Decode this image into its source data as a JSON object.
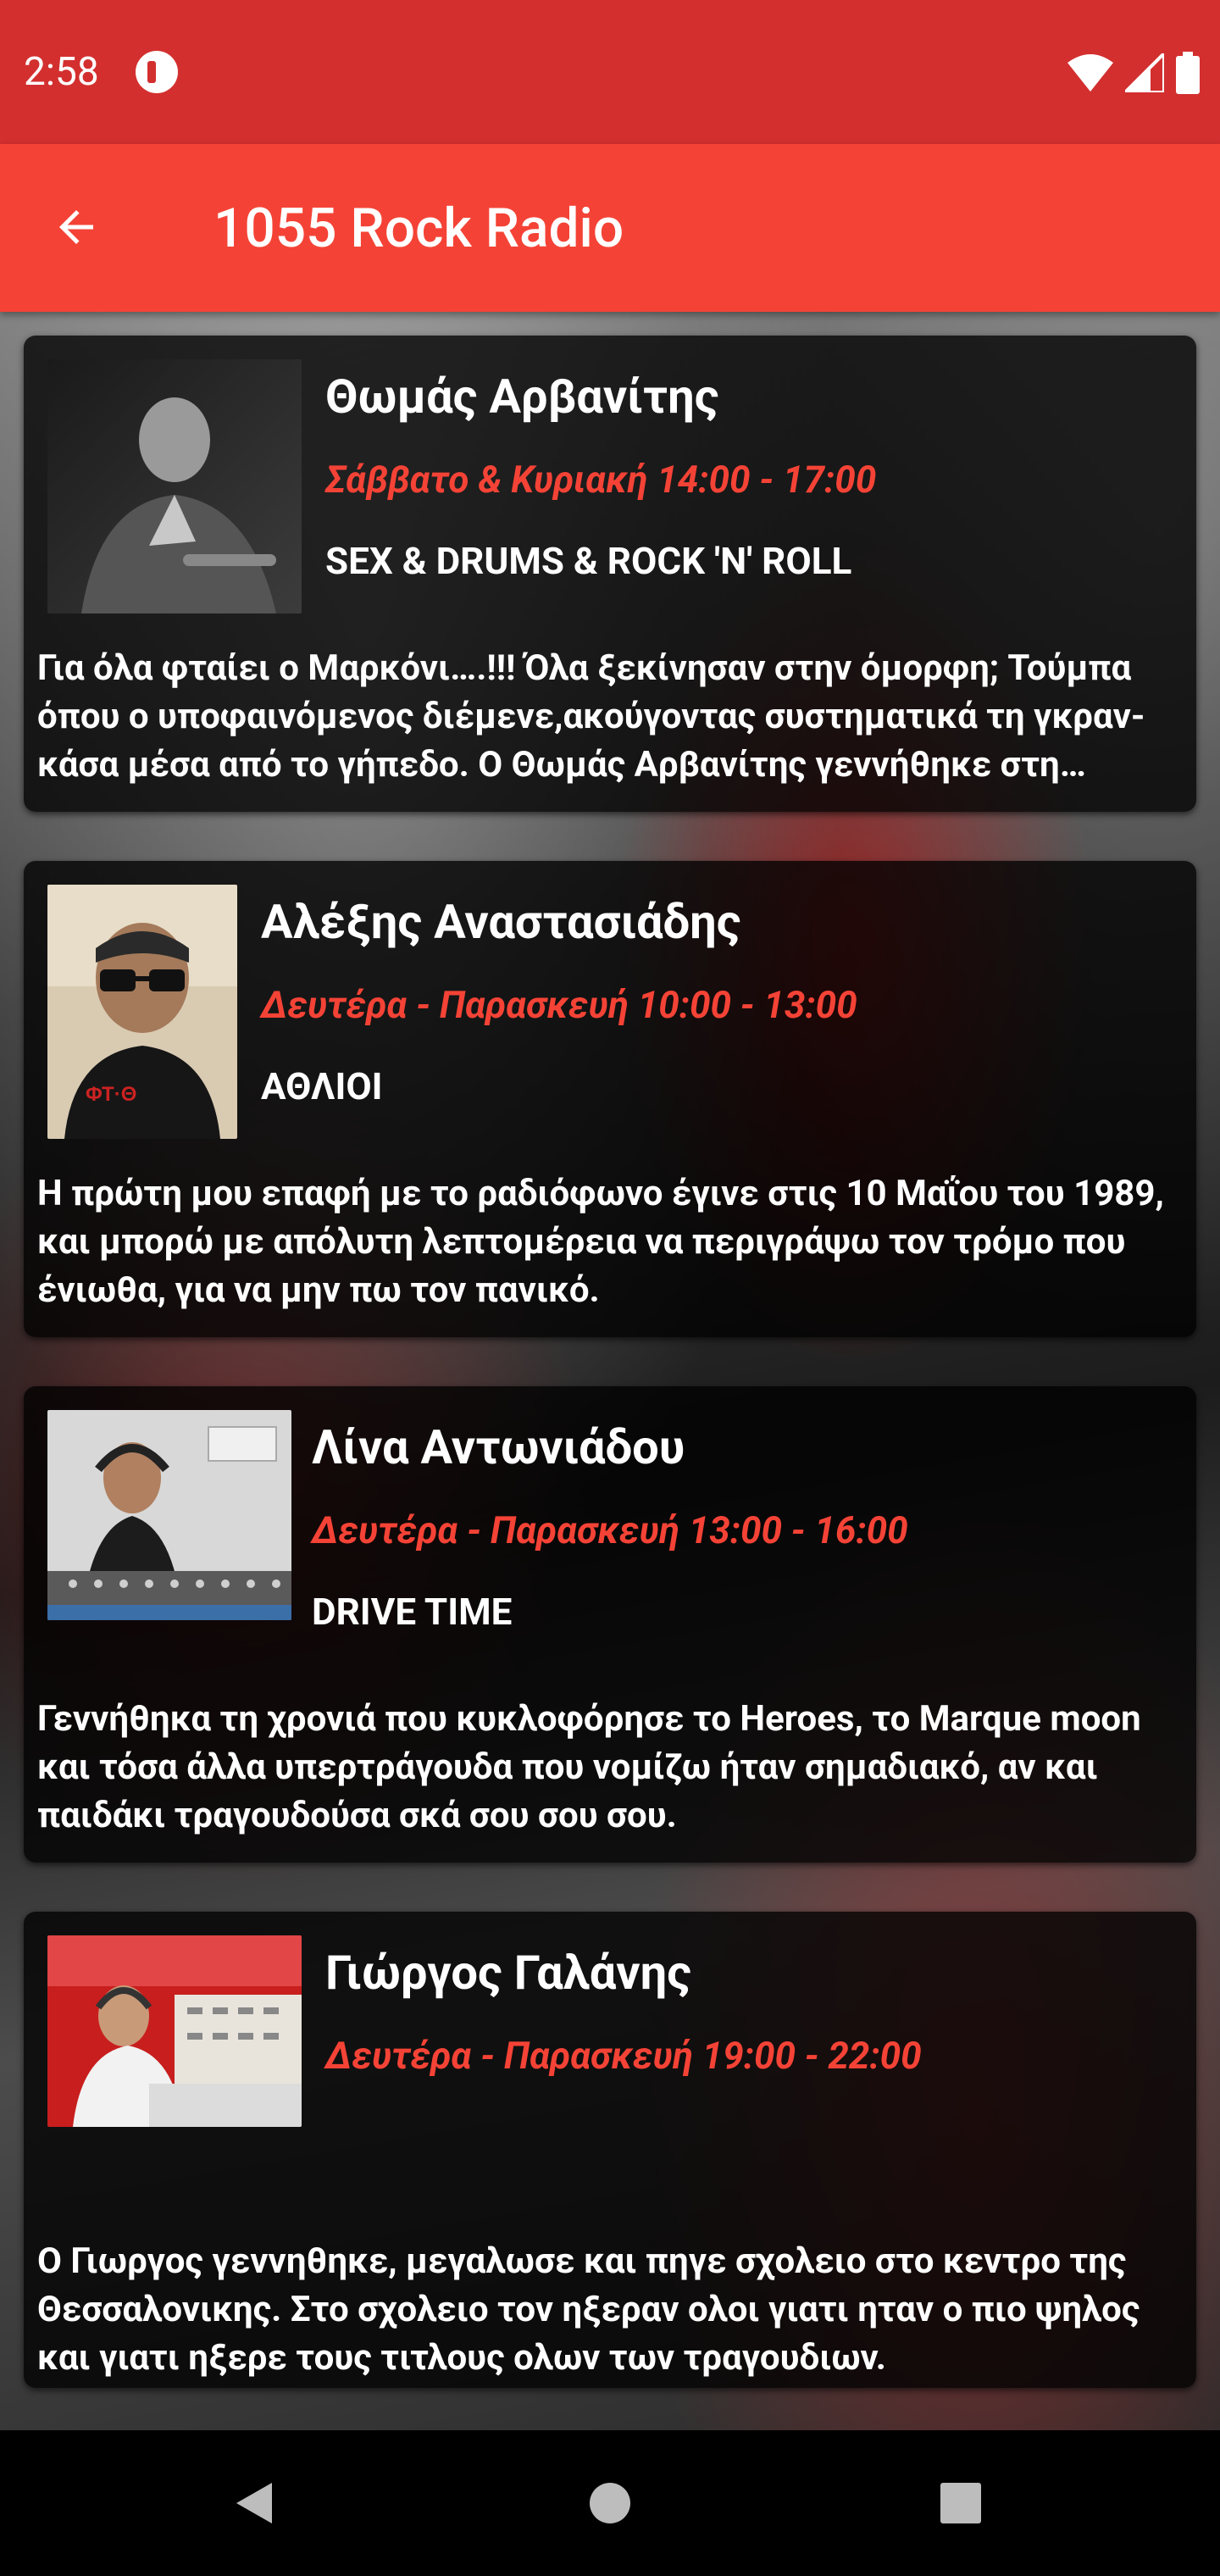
{
  "status_bar": {
    "time": "2:58"
  },
  "app_bar": {
    "title": "1055 Rock Radio"
  },
  "colors": {
    "status_bar": "#d32f2f",
    "app_bar": "#f44336",
    "schedule_text": "#f44336",
    "card_background": "rgba(0,0,0,0.78)"
  },
  "icons": {
    "back": "arrow-back-icon",
    "wifi": "wifi-icon",
    "signal": "signal-icon",
    "battery": "battery-icon",
    "nav_back": "triangle-back-icon",
    "nav_home": "circle-home-icon",
    "nav_recents": "square-recents-icon"
  },
  "producers": [
    {
      "name": "Θωμάς Αρβανίτης",
      "schedule": "Σάββατο & Κυριακή 14:00 - 17:00",
      "show": "SEX & DRUMS & ROCK 'N' ROLL",
      "description": "Για όλα φταίει ο Μαρκόνι….!!! Όλα ξεκίνησαν στην όμορφη; Τούμπα όπου ο υποφαινόμενος διέμενε,ακούγοντας συστηματικά τη γκραν-κάσα μέσα από το γήπεδο. Ο Θωμάς Αρβανίτης γεννήθηκε στη Θεσσαλονίκη."
    },
    {
      "name": "Αλέξης Αναστασιάδης",
      "schedule": "Δευτέρα - Παρασκευή 10:00 - 13:00",
      "show": "ΑΘΛΙΟΙ",
      "description": "Η πρώτη μου επαφή με το ραδιόφωνο έγινε στις 10 Μαΐου του 1989, και μπορώ με απόλυτη λεπτομέρεια να περιγράψω τον τρόμο που ένιωθα, για να μην πω τον πανικό."
    },
    {
      "name": "Λίνα Αντωνιάδου",
      "schedule": "Δευτέρα - Παρασκευή 13:00 - 16:00",
      "show": "DRIVE TIME",
      "description": "Γεννήθηκα τη χρονιά που κυκλοφόρησε το Heroes, το Marque moon και τόσα άλλα υπερτράγουδα που νομίζω ήταν σημαδιακό, αν και παιδάκι τραγουδούσα σκά σου σου σου."
    },
    {
      "name": "Γιώργος Γαλάνης",
      "schedule": "Δευτέρα - Παρασκευή 19:00 - 22:00",
      "show": "",
      "description": "Ο Γιωργος γεννηθηκε, μεγαλωσε και πηγε σχολειο στο κεντρο της Θεσσαλονικης. Στο σχολειο τον ηξεραν ολοι γιατι ηταν ο πιο ψηλος και γιατι ηξερε τους τιτλους ολων των τραγουδιων."
    }
  ]
}
